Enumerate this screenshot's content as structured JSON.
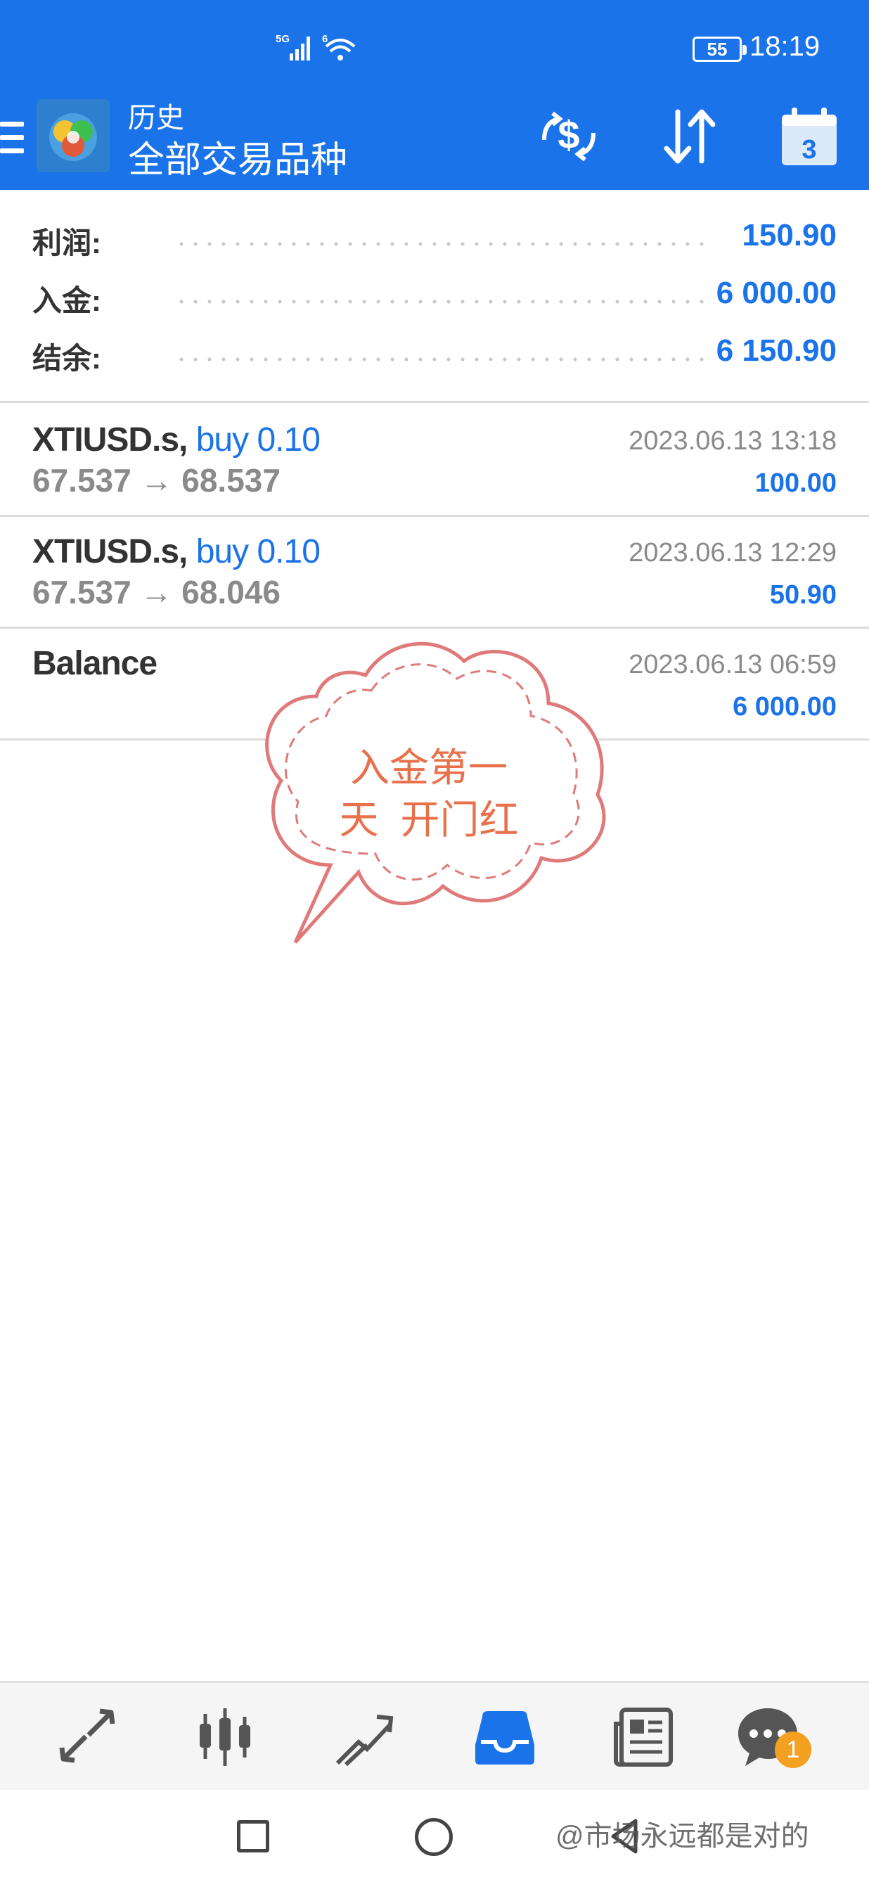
{
  "status_bar": {
    "network": "5G",
    "wifi_label": "6",
    "battery": "55",
    "time": "18:19"
  },
  "app_bar": {
    "title": "历史",
    "subtitle": "全部交易品种",
    "icons": [
      "menu-icon",
      "app-logo",
      "deposit-currency-icon",
      "sort-icon",
      "calendar-icon"
    ],
    "calendar_day": "3",
    "accent": "#1a73e8"
  },
  "summary": [
    {
      "label": "利润:",
      "value": "150.90"
    },
    {
      "label": "入金:",
      "value": "6 000.00"
    },
    {
      "label": "结余:",
      "value": "6 150.90"
    }
  ],
  "deals": [
    {
      "symbol": "XTIUSD.s,",
      "type": "buy 0.10",
      "prices": "67.537 → 68.537",
      "time": "2023.06.13 13:18",
      "profit": "100.00"
    },
    {
      "symbol": "XTIUSD.s,",
      "type": "buy 0.10",
      "prices": "67.537 → 68.046",
      "time": "2023.06.13 12:29",
      "profit": "50.90"
    },
    {
      "symbol": "Balance",
      "type": "",
      "prices": "",
      "time": "2023.06.13 06:59",
      "profit": "6 000.00"
    }
  ],
  "sticker": {
    "line1": "入金第一",
    "line2": "天  开门红",
    "color": "#e8704a"
  },
  "bottom_nav": {
    "items": [
      "quotes-icon",
      "chart-icon",
      "trade-icon",
      "history-icon",
      "news-icon",
      "chat-icon"
    ],
    "active": "history-icon",
    "chat_badge": "1"
  },
  "watermark": "@市场永远都是对的"
}
